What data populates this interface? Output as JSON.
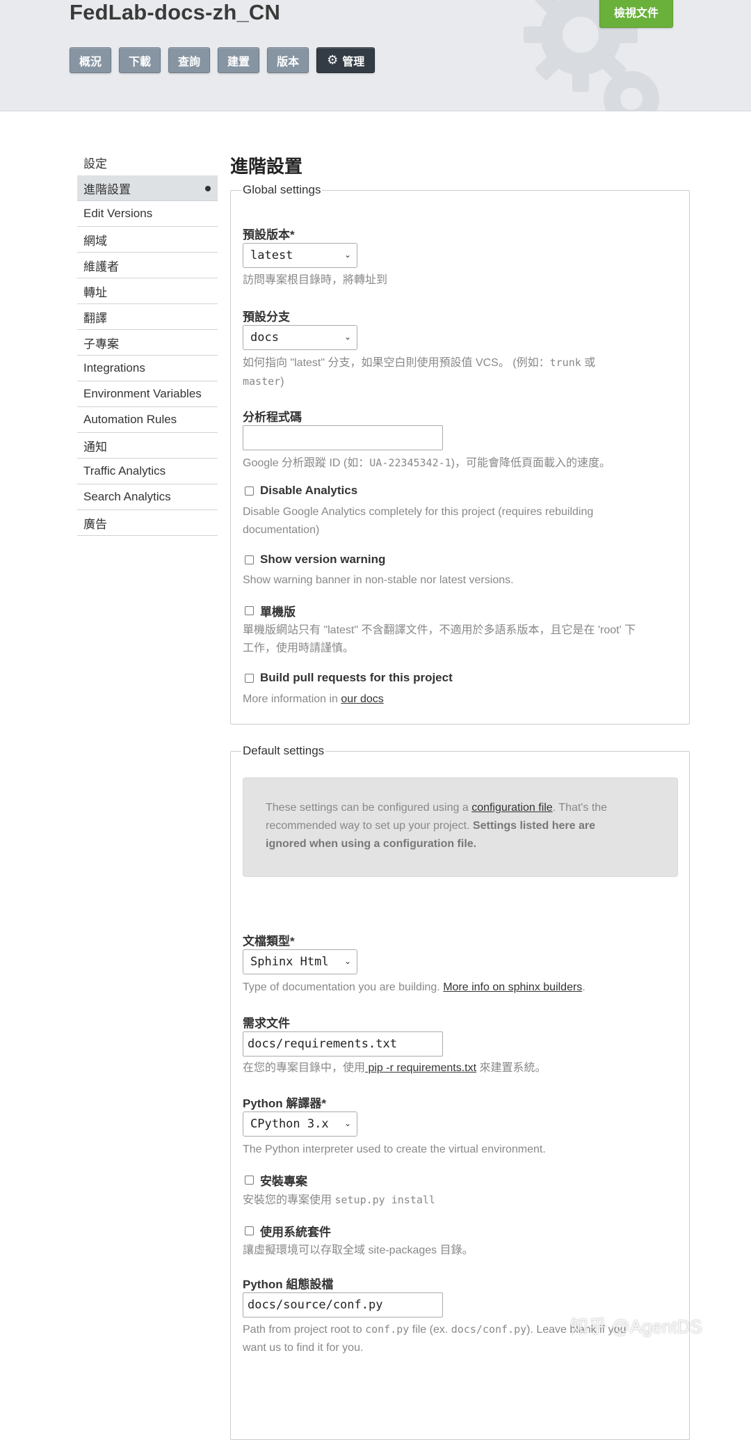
{
  "header": {
    "project_title": "FedLab-docs-zh_CN",
    "view_docs_label": "檢視文件",
    "tabs": [
      {
        "label": "概況"
      },
      {
        "label": "下載"
      },
      {
        "label": "查詢"
      },
      {
        "label": "建置"
      },
      {
        "label": "版本"
      },
      {
        "label": "管理",
        "icon": "gear-icon",
        "active": true
      }
    ]
  },
  "sidebar": {
    "items": [
      {
        "label": "設定"
      },
      {
        "label": "進階設置",
        "active": true
      },
      {
        "label": "Edit Versions"
      },
      {
        "label": "網域"
      },
      {
        "label": "維護者"
      },
      {
        "label": "轉址"
      },
      {
        "label": "翻譯"
      },
      {
        "label": "子專案"
      },
      {
        "label": "Integrations"
      },
      {
        "label": "Environment Variables"
      },
      {
        "label": "Automation Rules"
      },
      {
        "label": "通知"
      },
      {
        "label": "Traffic Analytics"
      },
      {
        "label": "Search Analytics"
      },
      {
        "label": "廣告"
      }
    ]
  },
  "main": {
    "title": "進階設置",
    "global": {
      "legend": "Global settings",
      "default_version": {
        "label": "預設版本*",
        "value": "latest",
        "help": "訪問專案根目錄時，將轉址到"
      },
      "default_branch": {
        "label": "預設分支",
        "value": "docs",
        "help_1": "如何指向 \"latest\" 分支，如果空白則使用預設值 VCS。 (例如：",
        "help_code_1": "trunk",
        "help_2": " 或",
        "help_code_2": "master",
        "help_3": ")"
      },
      "analytics_code": {
        "label": "分析程式碼",
        "value": "",
        "help_1": "Google 分析跟蹤 ID (如：",
        "help_code": "UA-22345342-1",
        "help_2": ")，可能會降低頁面載入的速度。"
      },
      "disable_analytics": {
        "label": "Disable Analytics",
        "checked": false,
        "help_1": "Disable Google Analytics completely for this project (requires rebuilding",
        "help_2": "documentation)"
      },
      "show_version_warning": {
        "label": "Show version warning",
        "checked": false,
        "help": "Show warning banner in non-stable nor latest versions."
      },
      "single_version": {
        "label": "單機版",
        "checked": false,
        "help_1": "單機版網站只有 \"latest\" 不含翻譯文件，不適用於多語系版本，且它是在 'root' 下",
        "help_2": "工作，使用時請謹慎。"
      },
      "build_prs": {
        "label": "Build pull requests for this project",
        "checked": false,
        "help": "More information in ",
        "link": "our docs"
      }
    },
    "defaults": {
      "legend": "Default settings",
      "note_1": "These settings can be configured using a ",
      "note_link": "configuration file",
      "note_2": ". That's the",
      "note_3": "recommended way to set up your project. ",
      "note_bold_1": "Settings listed here are",
      "note_bold_2": "ignored when using a configuration file.",
      "doc_type": {
        "label": "文檔類型*",
        "value": "Sphinx Html",
        "help": "Type of documentation you are building. ",
        "link": "More info on sphinx builders",
        "help_end": "."
      },
      "requirements": {
        "label": "需求文件",
        "value": "docs/requirements.txt",
        "help_1": "在您的專案目錄中，使用",
        "link": " pip -r requirements.txt",
        "help_2": " 來建置系統。"
      },
      "python_interpreter": {
        "label": "Python 解譯器*",
        "value": "CPython 3.x",
        "help": "The Python interpreter used to create the virtual environment."
      },
      "install_project": {
        "label": "安裝專案",
        "checked": false,
        "help_1": "安裝您的專案使用 ",
        "help_code": "setup.py install"
      },
      "system_packages": {
        "label": "使用系統套件",
        "checked": false,
        "help": "讓虛擬環境可以存取全域 site-packages 目錄。"
      },
      "python_conf": {
        "label": "Python 組態設檔",
        "value": "docs/source/conf.py",
        "help_1": "Path from project root to ",
        "help_code_1": "conf.py",
        "help_2": " file (ex. ",
        "help_code_2": "docs/conf.py",
        "help_3": "). Leave blank if you",
        "help_4": "want us to find it for you."
      }
    }
  },
  "watermark": "知乎 @AgentDS"
}
